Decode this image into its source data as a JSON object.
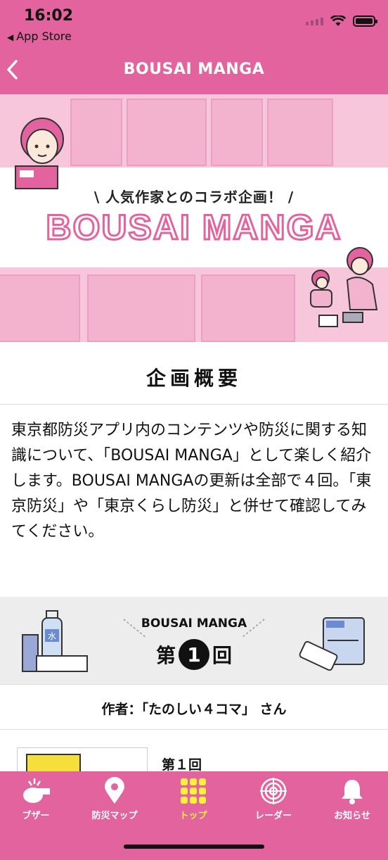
{
  "status": {
    "time": "16:02",
    "back_app": "App Store"
  },
  "nav": {
    "title": "BOUSAI MANGA"
  },
  "hero": {
    "subtitle": "\\ 人気作家とのコラボ企画！ /",
    "title": "BOUSAI MANGA"
  },
  "overview": {
    "heading": "企画概要",
    "body": "東京都防災アプリ内のコンテンツや防災に関する知識について、「BOUSAI MANGA」として楽しく紹介します。BOUSAI MANGAの更新は全部で４回。「東京防災」や「東京くらし防災」と併せて確認してみてください。"
  },
  "episode": {
    "caption": "BOUSAI MANGA",
    "number_prefix": "第",
    "number": "1",
    "number_suffix": "回",
    "author": "作者：「たのしい４コマ」 さん",
    "item_title": "第１回"
  },
  "tabs": [
    {
      "label": "ブザー",
      "icon": "whistle-icon"
    },
    {
      "label": "防災マップ",
      "icon": "map-pin-icon"
    },
    {
      "label": "トップ",
      "icon": "grid-icon",
      "active": true
    },
    {
      "label": "レーダー",
      "icon": "radar-icon"
    },
    {
      "label": "お知らせ",
      "icon": "bell-icon"
    }
  ],
  "colors": {
    "brand_pink": "#e2639d",
    "active_tab": "#fff03c"
  }
}
